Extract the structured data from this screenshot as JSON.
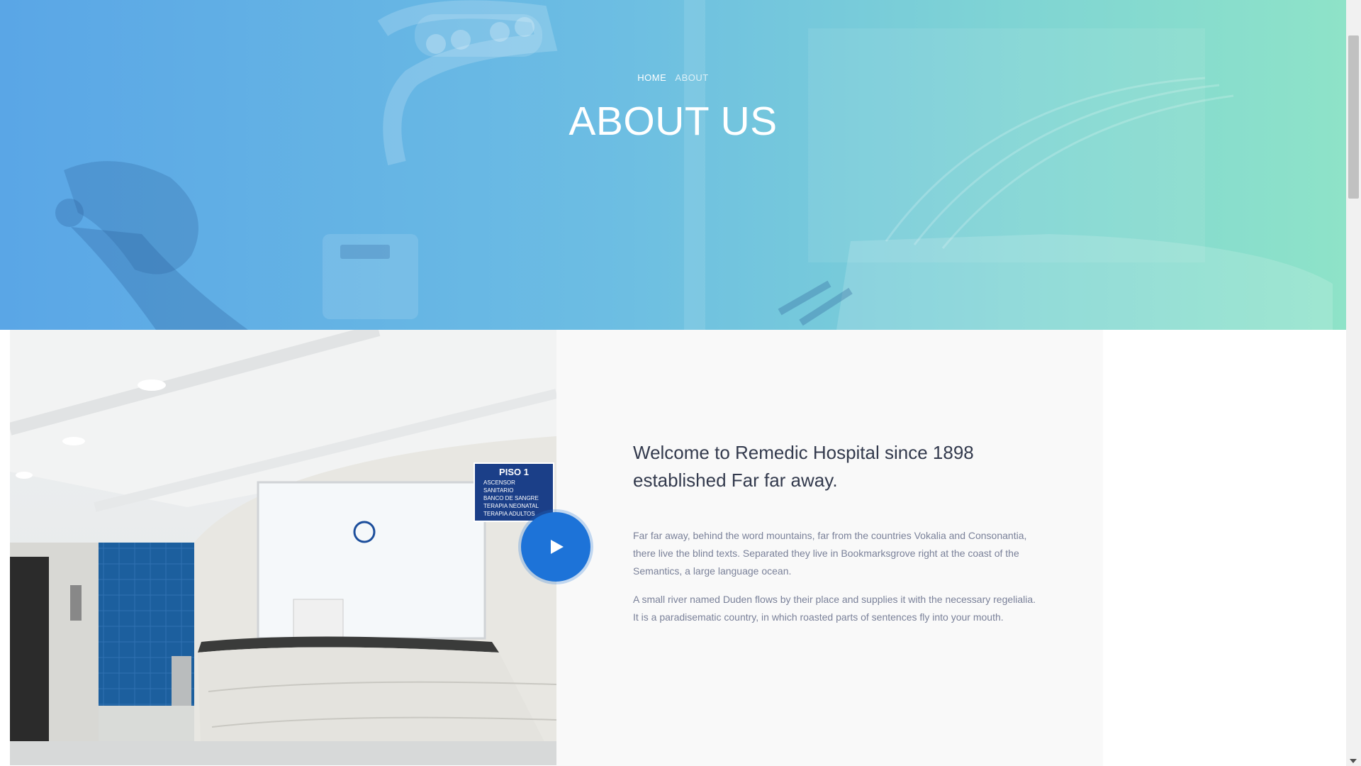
{
  "hero": {
    "breadcrumb": {
      "home": "HOME",
      "current": "ABOUT"
    },
    "title": "ABOUT US"
  },
  "about": {
    "heading": "Welcome to Remedic Hospital since 1898 established Far far away.",
    "paragraphs": [
      "Far far away, behind the word mountains, far from the countries Vokalia and Consonantia, there live the blind texts. Separated they live in Bookmarksgrove right at the coast of the Semantics, a large language ocean.",
      "A small river named Duden flows by their place and supplies it with the necessary regelialia. It is a paradisematic country, in which roasted parts of sentences fly into your mouth."
    ],
    "image_sign": {
      "title": "PISO 1",
      "items": [
        "ASCENSOR",
        "SANITARIO",
        "BANCO DE SANGRE",
        "TERAPIA NEONATAL",
        "TERAPIA ADULTOS"
      ]
    }
  },
  "icons": {
    "play": "play-icon"
  },
  "colors": {
    "hero_gradient_start": "#5aa6e6",
    "hero_gradient_end": "#8ee3c8",
    "play_button": "#1d73d8",
    "heading_text": "#333a4d",
    "body_text": "#7a8199"
  }
}
